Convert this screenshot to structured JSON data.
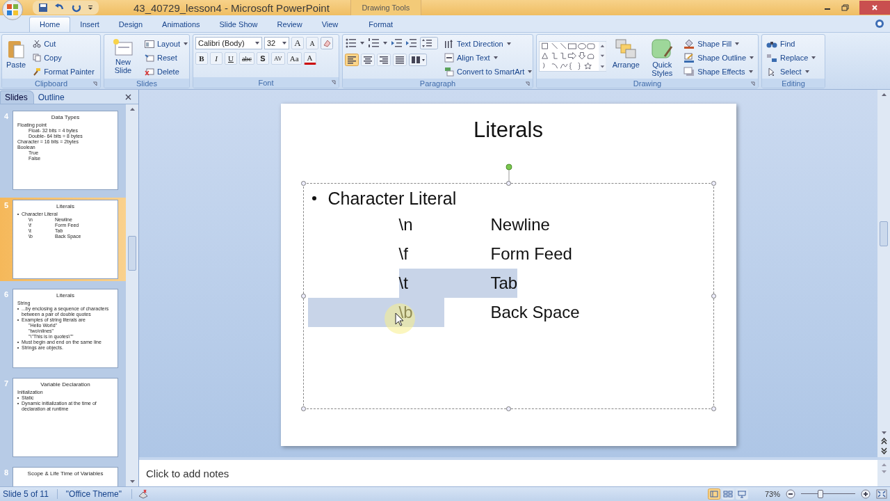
{
  "title_bar": {
    "title": "43_40729_lesson4 - Microsoft PowerPoint",
    "context_group": "Drawing Tools"
  },
  "tabs": [
    {
      "label": "Home",
      "selected": true
    },
    {
      "label": "Insert",
      "selected": false
    },
    {
      "label": "Design",
      "selected": false
    },
    {
      "label": "Animations",
      "selected": false
    },
    {
      "label": "Slide Show",
      "selected": false
    },
    {
      "label": "Review",
      "selected": false
    },
    {
      "label": "View",
      "selected": false
    },
    {
      "label": "Format",
      "selected": false
    }
  ],
  "ribbon": {
    "clipboard": {
      "label": "Clipboard",
      "paste": "Paste",
      "cut": "Cut",
      "copy": "Copy",
      "format_painter": "Format Painter"
    },
    "slides": {
      "label": "Slides",
      "new_slide": "New Slide",
      "layout": "Layout",
      "reset": "Reset",
      "delete": "Delete"
    },
    "font": {
      "label": "Font",
      "font_name": "Calibri (Body)",
      "font_size": "32",
      "size_buttons": [
        "A",
        "A"
      ],
      "format_buttons": [
        "B",
        "I",
        "U",
        "abc",
        "S",
        "AV",
        "Aa",
        "A"
      ]
    },
    "paragraph": {
      "label": "Paragraph",
      "text_direction": "Text Direction",
      "align_text": "Align Text",
      "convert": "Convert to SmartArt",
      "alignments": [
        {
          "selected": true
        },
        {
          "selected": false
        },
        {
          "selected": false
        },
        {
          "selected": false
        }
      ]
    },
    "drawing": {
      "label": "Drawing",
      "arrange": "Arrange",
      "quick_styles": "Quick Styles",
      "shape_fill": "Shape Fill",
      "shape_outline": "Shape Outline",
      "shape_effects": "Shape Effects"
    },
    "editing": {
      "label": "Editing",
      "find": "Find",
      "replace": "Replace",
      "select": "Select"
    }
  },
  "side_panel": {
    "tabs": [
      {
        "label": "Slides",
        "selected": true
      },
      {
        "label": "Outline",
        "selected": false
      }
    ],
    "thumbnails": [
      {
        "number": "4",
        "selected": false,
        "title": "Data Types",
        "lines": [
          {
            "text": "Floating point",
            "bullet": false,
            "children": [
              {
                "text": "Float- 32 bits = 4 bytes"
              },
              {
                "text": "Double- 64 bits = 8 bytes"
              }
            ]
          },
          {
            "text": "Character = 16 bits = 2bytes",
            "bullet": false
          },
          {
            "text": "Boolean",
            "bullet": false,
            "children": [
              {
                "text": "True"
              },
              {
                "text": "False"
              }
            ]
          }
        ]
      },
      {
        "number": "5",
        "selected": true,
        "title": "Literals",
        "lines": [
          {
            "text": "Character Literal",
            "bullet": true,
            "children": [
              {
                "text": "\\n",
                "text_2": "Newline"
              },
              {
                "text": "\\f",
                "text_2": "Form Feed"
              },
              {
                "text": "\\t",
                "text_2": "Tab"
              },
              {
                "text": "\\b",
                "text_2": "Back Space"
              }
            ]
          }
        ]
      },
      {
        "number": "6",
        "selected": false,
        "title": "Literals",
        "lines": [
          {
            "text": "String",
            "bullet": false
          },
          {
            "text": "...by enclosing a sequence of characters between a pair of double quotes",
            "bullet": true
          },
          {
            "text": "Examples of string literals are",
            "bullet": true,
            "children": [
              {
                "text": "\"Hello World\""
              },
              {
                "text": "\"two\\nlines\""
              },
              {
                "text": "\"\\\"This is in quotes\\\"\""
              }
            ]
          },
          {
            "text": "Must begin and end on the same line",
            "bullet": true
          },
          {
            "text": "Strings are objects.",
            "bullet": true
          }
        ]
      },
      {
        "number": "7",
        "selected": false,
        "title": "Variable Declaration",
        "lines": [
          {
            "text": "Initialization",
            "bullet": false
          },
          {
            "text": "Static",
            "bullet": true
          },
          {
            "text": "Dynamic initialization at the time of declaration at runtime",
            "bullet": true
          }
        ]
      },
      {
        "number": "8",
        "selected": false,
        "title": "Scope & Life Time of Variables"
      }
    ]
  },
  "slide": {
    "title": "Literals",
    "bullet": "Character Literal",
    "rows": [
      {
        "code": "\\n",
        "meaning": "Newline",
        "indent_selected": false,
        "code_selected": false,
        "meaning_selected": false
      },
      {
        "code": "\\f",
        "meaning": "Form Feed",
        "indent_selected": false,
        "code_selected": false,
        "meaning_selected": false
      },
      {
        "code": "\\t",
        "meaning": "Tab",
        "indent_selected": false,
        "code_selected": true,
        "meaning_selected": true
      },
      {
        "code": "\\b",
        "meaning": "Back Space",
        "indent_selected": true,
        "code_selected": true,
        "meaning_selected": false
      }
    ]
  },
  "notes": {
    "placeholder": "Click to add notes"
  },
  "status_bar": {
    "slide_info": "Slide 5 of 11",
    "theme": "\"Office Theme\"",
    "views": [
      {
        "selected": true
      },
      {
        "selected": false
      },
      {
        "selected": false
      }
    ],
    "zoom": "73%",
    "zoom_slider": {
      "level": 0.36
    }
  }
}
